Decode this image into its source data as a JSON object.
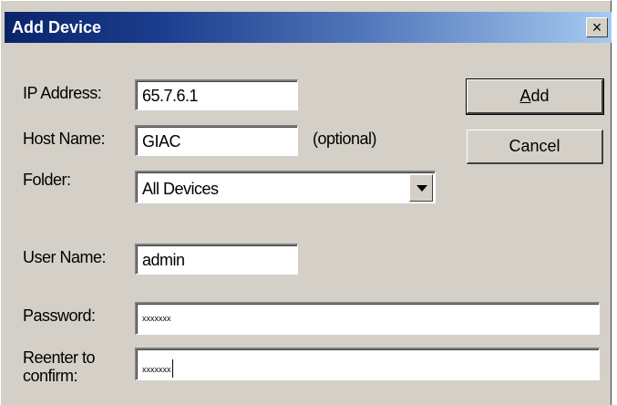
{
  "dialog": {
    "title": "Add Device",
    "close_glyph": "×"
  },
  "fields": {
    "ip_label": "IP Address:",
    "ip_value": "65.7.6.1",
    "host_label": "Host Name:",
    "host_value": "GIAC",
    "host_hint": "(optional)",
    "folder_label": "Folder:",
    "folder_value": "All Devices",
    "user_label": "User Name:",
    "user_value": "admin",
    "password_label": "Password:",
    "password_value": "xxxxxxx",
    "reenter_label_line1": "Reenter to",
    "reenter_label_line2": "confirm:",
    "reenter_value": "xxxxxxx"
  },
  "buttons": {
    "add_mnemonic": "A",
    "add_rest": "dd",
    "cancel": "Cancel"
  },
  "icons": {
    "folder_dropdown": "chevron-down-icon",
    "close": "close-icon"
  }
}
